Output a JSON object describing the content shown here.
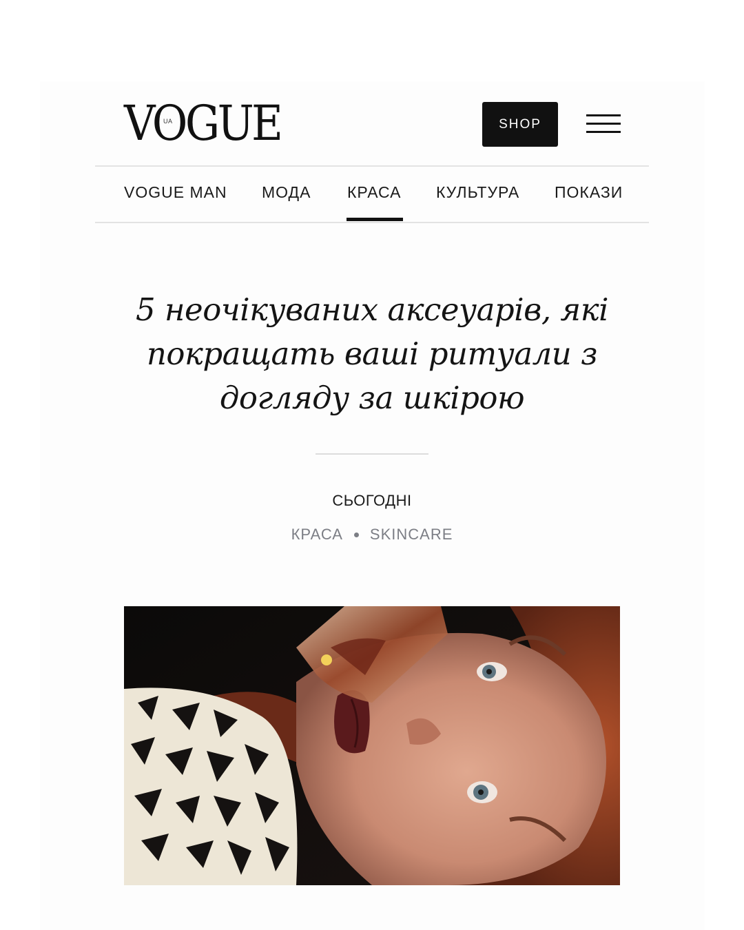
{
  "header": {
    "logo_text": "VOGUE",
    "logo_sup": "UA",
    "shop_label": "SHOP",
    "menu_icon": "hamburger-icon"
  },
  "nav": {
    "items": [
      {
        "label": "VOGUE MAN",
        "active": false
      },
      {
        "label": "МОДА",
        "active": false
      },
      {
        "label": "КРАСА",
        "active": true
      },
      {
        "label": "КУЛЬТУРА",
        "active": false
      },
      {
        "label": "ПОКАЗИ",
        "active": false
      }
    ]
  },
  "article": {
    "title_lines": [
      "5 неочікуваних аксеуарів, які",
      "покращать ваші ритуали з",
      "догляду за шкірою"
    ],
    "date": "СЬОГОДНІ",
    "tags": [
      "КРАСА",
      "SKINCARE"
    ]
  },
  "colors": {
    "text": "#111111",
    "muted": "#7c7e85",
    "button_bg": "#111111",
    "button_text": "#ffffff",
    "divider": "#e3e3e3"
  }
}
